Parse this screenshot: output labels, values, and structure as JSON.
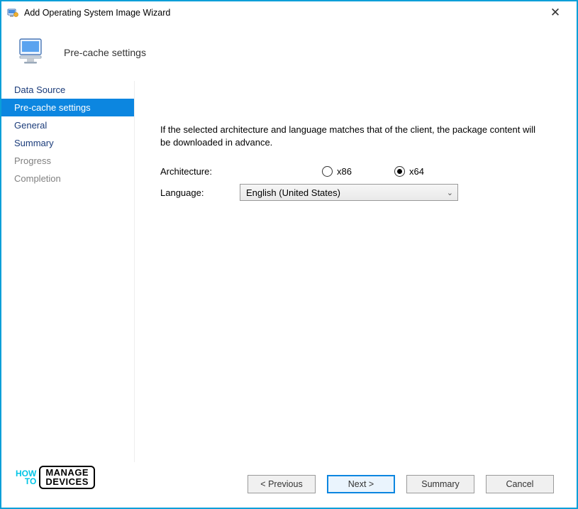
{
  "window": {
    "title": "Add Operating System Image Wizard"
  },
  "header": {
    "page_title": "Pre-cache settings"
  },
  "sidebar": {
    "items": [
      {
        "label": "Data Source",
        "state": "normal"
      },
      {
        "label": "Pre-cache settings",
        "state": "active"
      },
      {
        "label": "General",
        "state": "normal"
      },
      {
        "label": "Summary",
        "state": "normal"
      },
      {
        "label": "Progress",
        "state": "muted"
      },
      {
        "label": "Completion",
        "state": "muted"
      }
    ]
  },
  "main": {
    "description": "If the selected architecture and language matches that of the client, the package content will be downloaded in advance.",
    "architecture_label": "Architecture:",
    "architecture_options": {
      "x86": "x86",
      "x64": "x64"
    },
    "architecture_selected": "x64",
    "language_label": "Language:",
    "language_selected": "English (United States)"
  },
  "footer": {
    "previous": "< Previous",
    "next": "Next >",
    "summary": "Summary",
    "cancel": "Cancel"
  },
  "watermark": {
    "how": "HOW",
    "to": "TO",
    "line1": "MANAGE",
    "line2": "DEVICES"
  }
}
